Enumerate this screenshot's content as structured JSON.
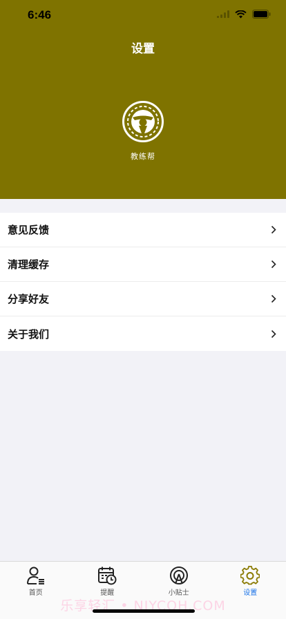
{
  "status_bar": {
    "time": "6:46"
  },
  "header": {
    "title": "设置",
    "app_name": "教练帮"
  },
  "menu": {
    "items": [
      {
        "label": "意见反馈"
      },
      {
        "label": "清理缓存"
      },
      {
        "label": "分享好友"
      },
      {
        "label": "关于我们"
      }
    ]
  },
  "tabbar": {
    "tabs": [
      {
        "label": "首页",
        "icon": "user-list-icon"
      },
      {
        "label": "提醒",
        "icon": "calendar-clock-icon"
      },
      {
        "label": "小贴士",
        "icon": "tips-icon"
      },
      {
        "label": "设置",
        "icon": "gear-icon",
        "active": true
      }
    ]
  },
  "watermark": "乐享轻汇 • NJYCQH.COM",
  "colors": {
    "header_bg": "#7f7300",
    "active_tab": "#1a73e8",
    "active_icon": "#8a7a00"
  }
}
